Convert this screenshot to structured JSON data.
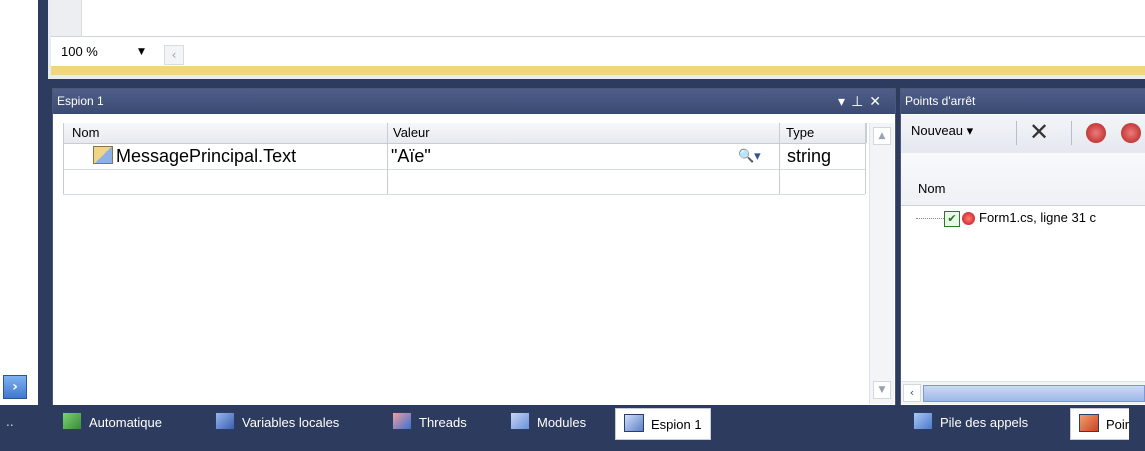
{
  "editor": {
    "zoom_value": "100 %",
    "zoom_dropdown_icon": "caret-down",
    "scroll_left_icon": "chevron-left"
  },
  "watch": {
    "title": "Espion 1",
    "title_buttons_icons": [
      "dropdown-arrow",
      "pin",
      "close"
    ],
    "columns": [
      "Nom",
      "Valeur",
      "Type"
    ],
    "rows": [
      {
        "name": "MessagePrincipal.Text",
        "value": "\"Aïe\"",
        "type": "string"
      },
      {
        "name": "",
        "value": "",
        "type": ""
      }
    ]
  },
  "breakpoints": {
    "title": "Points d'arrêt",
    "toolbar": {
      "new_label": "Nouveau"
    },
    "column_name": "Nom",
    "items": [
      {
        "label": "Form1.cs, ligne 31 c",
        "enabled": true
      }
    ]
  },
  "tabs": {
    "left": [
      {
        "label": "Automatique",
        "icon": "auto-icon",
        "active": false
      },
      {
        "label": "Variables locales",
        "icon": "locals-icon",
        "active": false
      },
      {
        "label": "Threads",
        "icon": "threads-icon",
        "active": false
      },
      {
        "label": "Modules",
        "icon": "modules-icon",
        "active": false
      },
      {
        "label": "Espion 1",
        "icon": "watch-icon",
        "active": true
      }
    ],
    "right": [
      {
        "label": "Pile des appels",
        "icon": "callstack-icon",
        "active": false
      },
      {
        "label": "Poir",
        "icon": "breakpoints-icon",
        "active": true
      }
    ]
  },
  "colors": {
    "panel_dark": "#2d3b5e",
    "title_bar": "#4e5e89",
    "highlight_yellow": "#f2d67f"
  }
}
